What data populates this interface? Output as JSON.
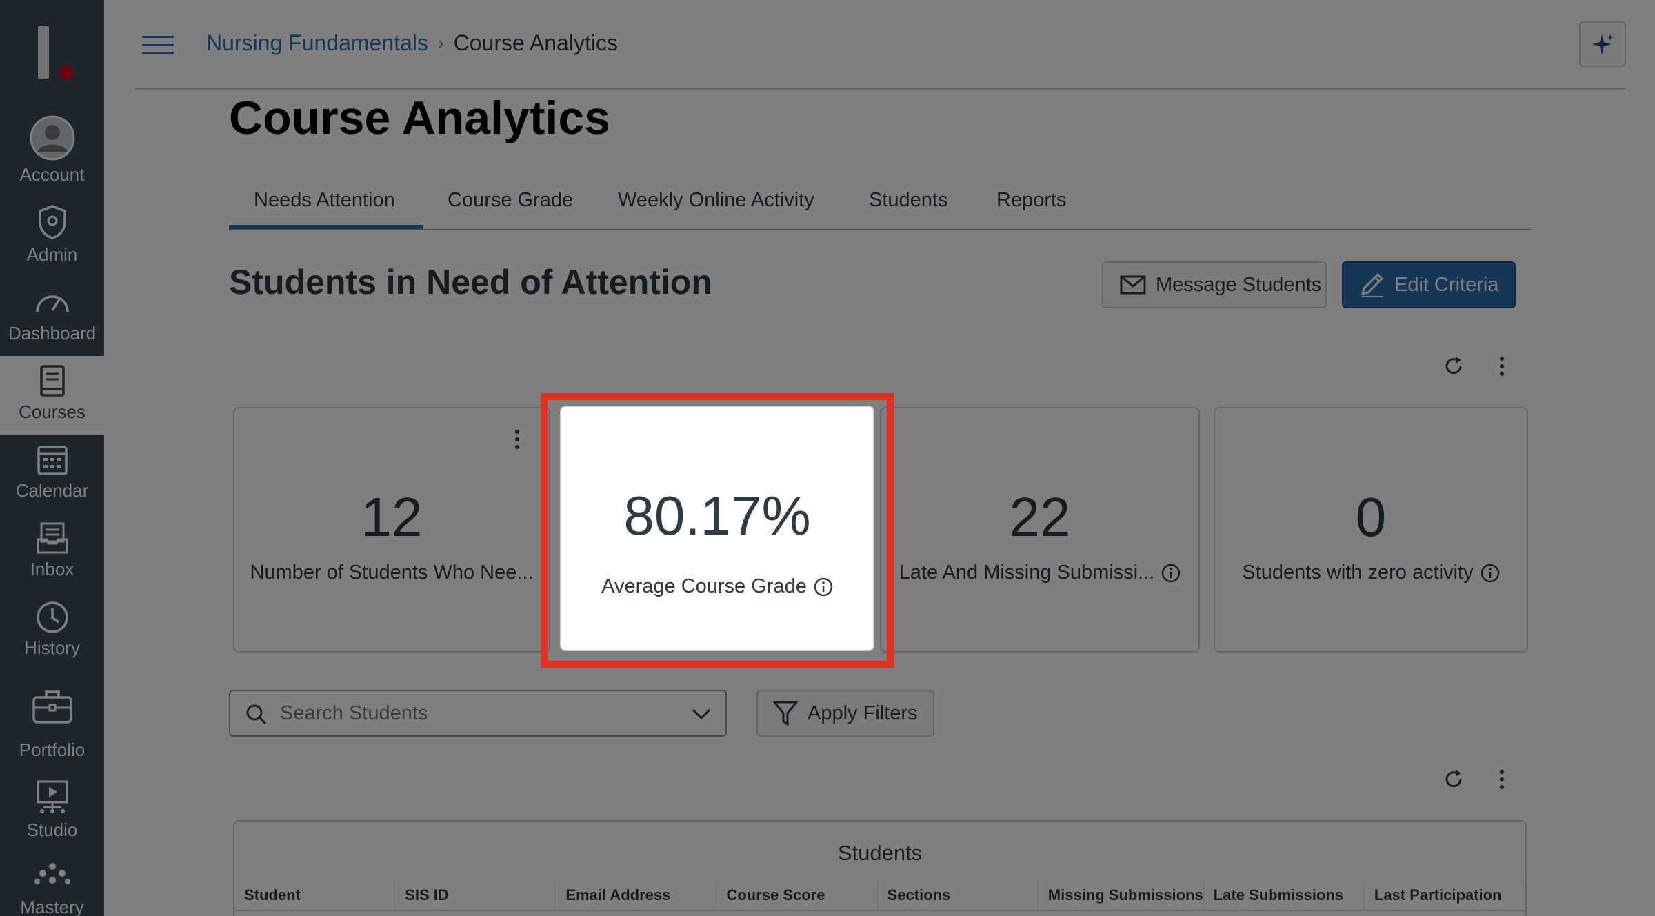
{
  "global_nav": {
    "items": [
      {
        "label": "Account",
        "icon": "account-icon"
      },
      {
        "label": "Admin",
        "icon": "admin-icon"
      },
      {
        "label": "Dashboard",
        "icon": "dashboard-icon"
      },
      {
        "label": "Courses",
        "icon": "courses-icon",
        "active": true
      },
      {
        "label": "Calendar",
        "icon": "calendar-icon"
      },
      {
        "label": "Inbox",
        "icon": "inbox-icon"
      },
      {
        "label": "History",
        "icon": "history-icon"
      },
      {
        "label": "Portfolio",
        "icon": "portfolio-icon"
      },
      {
        "label": "Studio",
        "icon": "studio-icon"
      },
      {
        "label": "Mastery",
        "icon": "mastery-icon"
      }
    ]
  },
  "header": {
    "breadcrumb": {
      "course": "Nursing Fundamentals",
      "separator": "›",
      "current": "Course Analytics"
    }
  },
  "page": {
    "title": "Course Analytics",
    "tabs": [
      {
        "label": "Needs Attention",
        "active": true
      },
      {
        "label": "Course Grade"
      },
      {
        "label": "Weekly Online Activity"
      },
      {
        "label": "Students"
      },
      {
        "label": "Reports"
      }
    ],
    "section_title": "Students in Need of Attention",
    "message_button": "Message Students",
    "edit_button": "Edit Criteria"
  },
  "cards": [
    {
      "value": "12",
      "label": "Number of Students Who Nee..."
    },
    {
      "value": "80.17%",
      "label": "Average Course Grade"
    },
    {
      "value": "22",
      "label": "Late And Missing Submissi..."
    },
    {
      "value": "0",
      "label": "Students with zero activity"
    }
  ],
  "search": {
    "placeholder": "Search Students"
  },
  "filter_button": "Apply Filters",
  "table": {
    "caption": "Students",
    "columns": [
      "Student",
      "SIS ID",
      "Email Address",
      "Course Score",
      "Sections",
      "Missing Submissions",
      "Late Submissions",
      "Last Participation"
    ]
  },
  "colors": {
    "nav_bg": "#394b58",
    "brand_blue": "#2d6eb1",
    "highlight": "#e4301e"
  }
}
